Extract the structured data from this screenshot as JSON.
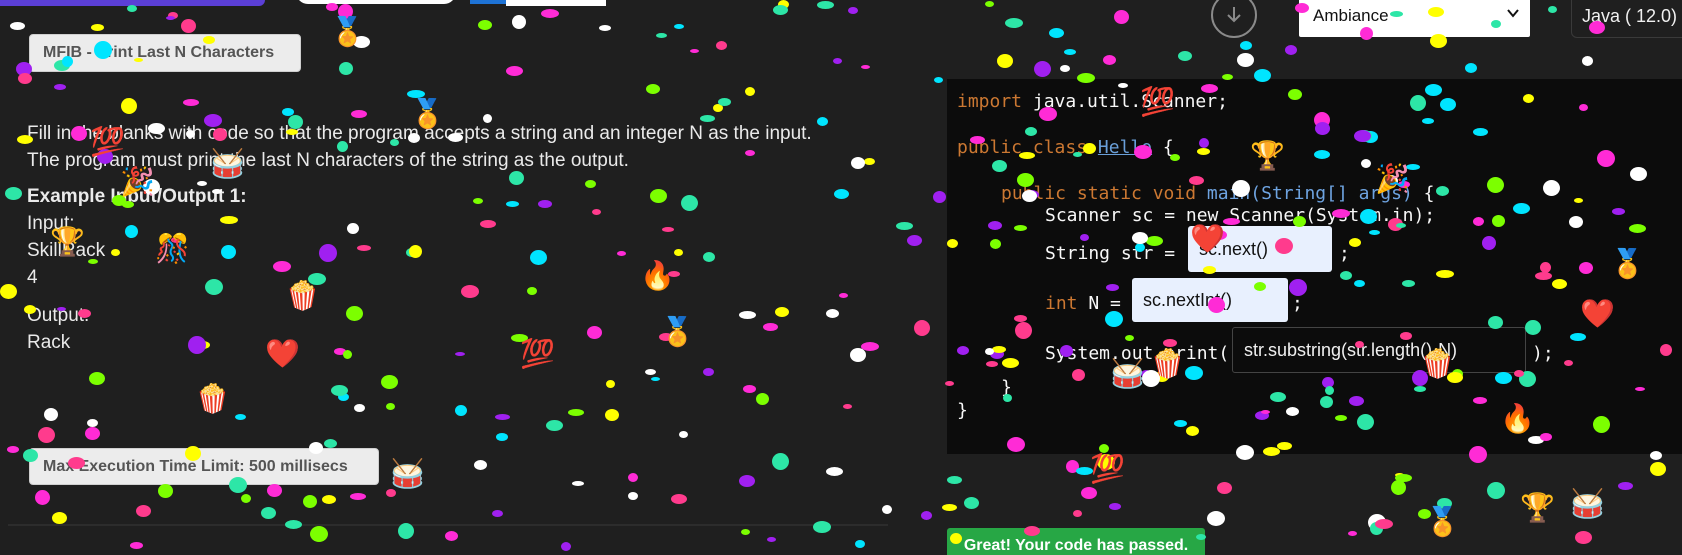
{
  "header": {
    "problem_title_button": "MFIB - Print Last N Characters",
    "theme_select": {
      "selected": "Ambiance"
    },
    "language_label": "Java ( 12.0)"
  },
  "problem": {
    "description_line1": "Fill in the blanks with code so that the program accepts a string and an integer N as the input.",
    "description_line2": "The program must print the last N characters of the string as the output.",
    "example_title": "Example Input/Output 1:",
    "input_label": "Input:",
    "input_lines": [
      "SkillRack",
      "4"
    ],
    "output_label": "Output:",
    "output_lines": [
      "Rack"
    ],
    "time_limit_button": "Max Execution Time Limit: 500 millisecs"
  },
  "editor": {
    "line_import_kw": "import",
    "line_import_rest": " java.util.Scanner;",
    "line_class_kw": "public class",
    "line_class_name": "Hello",
    "line_class_brace": " {",
    "line_main_kw": "public static void",
    "line_main_name": " main",
    "line_main_args": "(String[] args)",
    "line_main_brace": " {",
    "line_scanner": "Scanner sc = new Scanner(System.in);",
    "line_string_prefix": "String str = ",
    "blank1_value": "sc.next()",
    "line_string_suffix": ";",
    "line_int_kw": "int",
    "line_int_rest": " N = ",
    "blank2_value": "sc.nextInt()",
    "line_int_suffix": ";",
    "line_print_prefix": "System.out.print(",
    "blank3_value": "str.substring(str.length()-N)",
    "line_print_suffix": ");",
    "close_inner": "}",
    "close_outer": "}"
  },
  "status": {
    "success_message": "Great! Your code has passed."
  },
  "colors": {
    "background": "#1f1f1f",
    "editor_background": "#0c0c0c",
    "keyword": "#cc7832",
    "type": "#6ea3e0",
    "success": "#27a745",
    "accent_top": "#5b3fd6"
  },
  "icons": [
    "download-icon",
    "chevron-down-icon"
  ],
  "decorations": {
    "emojis": [
      "🏅",
      "🏅",
      "💯",
      "🥁",
      "🎉",
      "🎊",
      "🏆",
      "🍿",
      "❤️",
      "💯",
      "🔥",
      "🏅",
      "🍿",
      "🥁",
      "💯",
      "🏆",
      "❤️",
      "🎉",
      "🥁",
      "🍿",
      "💯",
      "🏅",
      "❤️",
      "🔥",
      "🍿",
      "🥁",
      "🏅",
      "🏆"
    ]
  }
}
